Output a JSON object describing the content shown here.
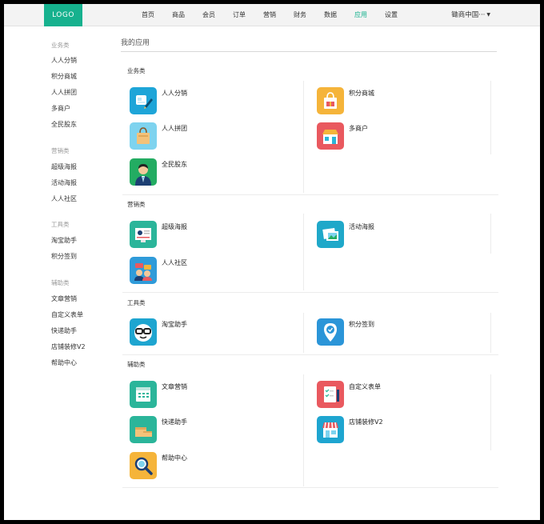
{
  "header": {
    "logo": "LOGO",
    "nav": [
      {
        "label": "首页"
      },
      {
        "label": "商品"
      },
      {
        "label": "会员"
      },
      {
        "label": "订单"
      },
      {
        "label": "营销"
      },
      {
        "label": "财务"
      },
      {
        "label": "数据"
      },
      {
        "label": "应用",
        "active": true
      },
      {
        "label": "设置"
      }
    ],
    "user": "锄商中国···"
  },
  "sidebar": {
    "groups": [
      {
        "title": "业务类",
        "items": [
          "人人分销",
          "积分商城",
          "人人拼团",
          "多商户",
          "全民股东"
        ]
      },
      {
        "title": "营销类",
        "items": [
          "超级海报",
          "活动海报",
          "人人社区"
        ]
      },
      {
        "title": "工具类",
        "items": [
          "淘宝助手",
          "积分签到"
        ]
      },
      {
        "title": "辅助类",
        "items": [
          "文章营销",
          "自定义表单",
          "快递助手",
          "店铺装修V2",
          "帮助中心"
        ]
      }
    ]
  },
  "main": {
    "title": "我的应用",
    "sections": [
      {
        "title": "业务类",
        "apps": [
          {
            "name": "人人分销",
            "icon": "distribution-icon",
            "color": "#1ea5d8"
          },
          {
            "name": "积分商城",
            "icon": "points-mall-icon",
            "color": "#f5b43a"
          },
          {
            "name": "人人拼团",
            "icon": "group-buy-icon",
            "color": "#7ed3ef"
          },
          {
            "name": "多商户",
            "icon": "multi-merchant-icon",
            "color": "#e9595f"
          },
          {
            "name": "全民股东",
            "icon": "shareholder-icon",
            "color": "#23ac62"
          }
        ]
      },
      {
        "title": "营销类",
        "apps": [
          {
            "name": "超级海报",
            "icon": "super-poster-icon",
            "color": "#2bb59a"
          },
          {
            "name": "活动海报",
            "icon": "event-poster-icon",
            "color": "#1fa8c9"
          },
          {
            "name": "人人社区",
            "icon": "community-icon",
            "color": "#2f9bd9"
          }
        ]
      },
      {
        "title": "工具类",
        "apps": [
          {
            "name": "淘宝助手",
            "icon": "taobao-helper-icon",
            "color": "#1ea5d0"
          },
          {
            "name": "积分签到",
            "icon": "checkin-icon",
            "color": "#2b95d8"
          }
        ]
      },
      {
        "title": "辅助类",
        "apps": [
          {
            "name": "文章营销",
            "icon": "article-icon",
            "color": "#2bb59a"
          },
          {
            "name": "自定义表单",
            "icon": "custom-form-icon",
            "color": "#e9595f"
          },
          {
            "name": "快递助手",
            "icon": "delivery-icon",
            "color": "#2bb59a"
          },
          {
            "name": "店铺装修V2",
            "icon": "shop-decor-icon",
            "color": "#1ea5d0"
          },
          {
            "name": "帮助中心",
            "icon": "help-center-icon",
            "color": "#f5b43a"
          }
        ]
      }
    ]
  }
}
